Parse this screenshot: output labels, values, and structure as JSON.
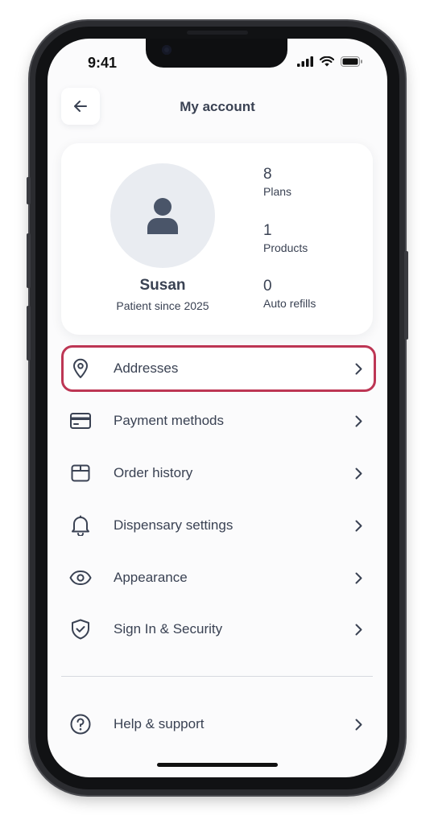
{
  "status_bar": {
    "time": "9:41"
  },
  "header": {
    "title": "My account",
    "back_icon": "arrow-left-icon"
  },
  "profile": {
    "name": "Susan",
    "since": "Patient since 2025",
    "stats": [
      {
        "value": "8",
        "label": "Plans"
      },
      {
        "value": "1",
        "label": "Products"
      },
      {
        "value": "0",
        "label": "Auto refills"
      }
    ]
  },
  "menu": {
    "addresses": "Addresses",
    "payment_methods": "Payment methods",
    "order_history": "Order history",
    "dispensary_settings": "Dispensary settings",
    "appearance": "Appearance",
    "sign_in_security": "Sign In & Security",
    "help_support": "Help & support"
  },
  "colors": {
    "highlight_border": "#bd3654",
    "text": "#3a4253",
    "avatar_bg": "#e9ecf1"
  }
}
